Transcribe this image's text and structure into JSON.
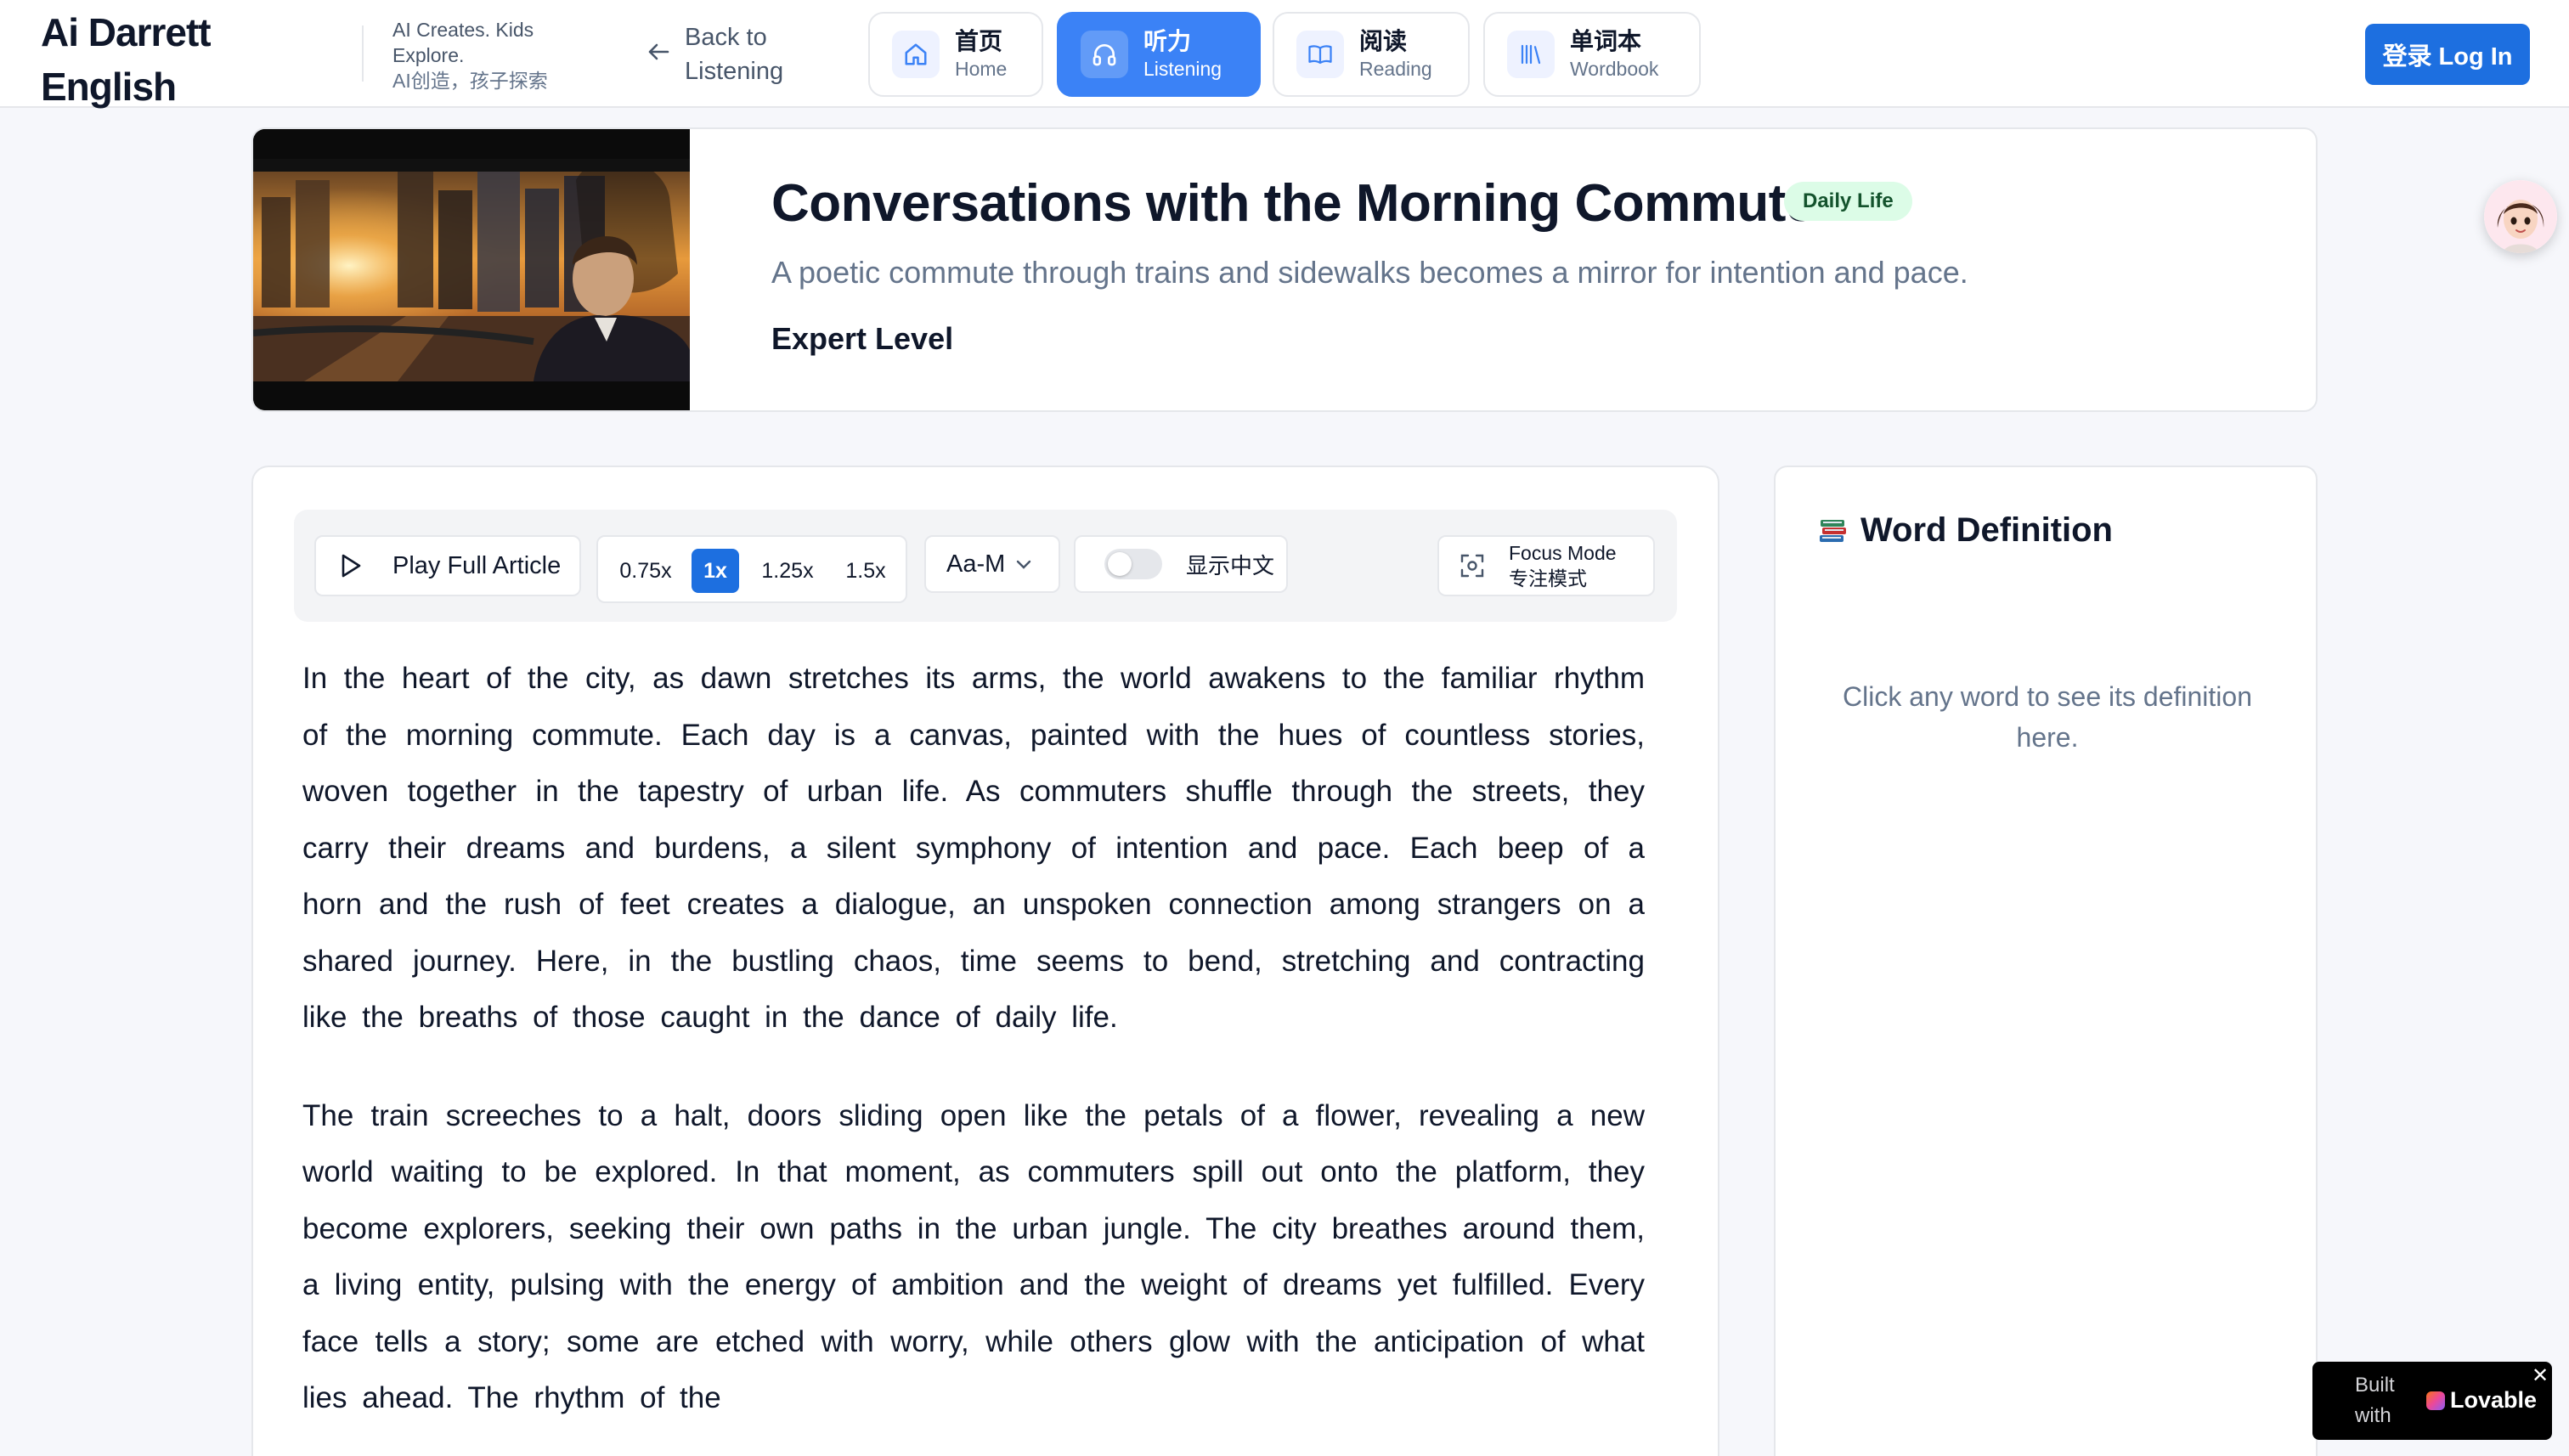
{
  "header": {
    "brand": "Ai Darrett\nEnglish",
    "tagline_en": "AI Creates. Kids Explore.",
    "tagline_zh": "AI创造，孩子探索",
    "back_label": "Back to Listening",
    "nav": [
      {
        "zh": "首页",
        "en": "Home",
        "icon": "home-icon"
      },
      {
        "zh": "听力",
        "en": "Listening",
        "icon": "headphones-icon",
        "active": true
      },
      {
        "zh": "阅读",
        "en": "Reading",
        "icon": "book-open-icon"
      },
      {
        "zh": "单词本",
        "en": "Wordbook",
        "icon": "library-icon"
      }
    ],
    "login_label": "登录 Log In"
  },
  "hero": {
    "title": "Conversations with the Morning Commute",
    "badge": "Daily Life",
    "subtitle": "A poetic commute through trains and sidewalks becomes a mirror for intention and pace.",
    "level": "Expert Level"
  },
  "toolbar": {
    "play_label": "Play Full Article",
    "speeds": [
      "0.75x",
      "1x",
      "1.25x",
      "1.5x"
    ],
    "active_speed": "1x",
    "font_size": "Aa-M",
    "show_chinese_label": "显示中文",
    "show_chinese": false,
    "focus_en": "Focus Mode",
    "focus_zh": "专注模式"
  },
  "article": {
    "paragraphs": [
      "In the heart of the city, as dawn stretches its arms, the world awakens to the familiar rhythm of the morning commute. Each day is a canvas, painted with the hues of countless stories, woven together in the tapestry of urban life. As commuters shuffle through the streets, they carry their dreams and burdens, a silent symphony of intention and pace. Each beep of a horn and the rush of feet creates a dialogue, an unspoken connection among strangers on a shared journey. Here, in the bustling chaos, time seems to bend, stretching and contracting like the breaths of those caught in the dance of daily life.",
      "The train screeches to a halt, doors sliding open like the petals of a flower, revealing a new world waiting to be explored. In that moment, as commuters spill out onto the platform, they become explorers, seeking their own paths in the urban jungle. The city breathes around them, a living entity, pulsing with the energy of ambition and the weight of dreams yet fulfilled. Every face tells a story; some are etched with worry, while others glow with the anticipation of what lies ahead. The rhythm of the"
    ]
  },
  "word_panel": {
    "title": "Word Definition",
    "hint": "Click any word to see its definition here."
  },
  "lovable": {
    "built_with": "Built with",
    "brand": "Lovable",
    "close": "✕"
  },
  "colors": {
    "accent": "#3b82f6",
    "primary_button": "#1d6fe0",
    "badge_bg": "#dcfce7"
  }
}
